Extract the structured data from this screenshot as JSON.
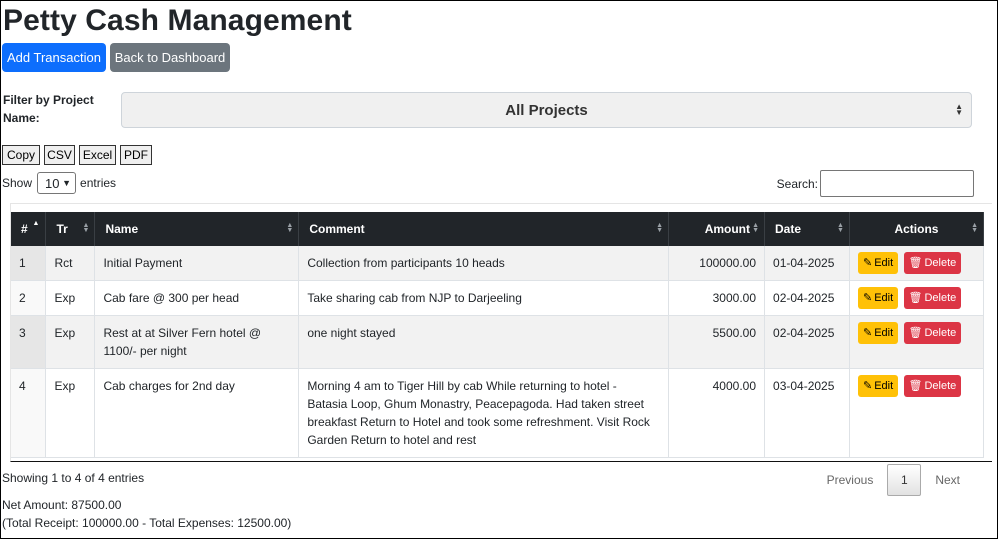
{
  "page": {
    "title": "Petty Cash Management"
  },
  "toolbar": {
    "add_label": "Add Transaction",
    "back_label": "Back to Dashboard"
  },
  "filter": {
    "label": "Filter by Project Name:",
    "selected": "All Projects"
  },
  "export": {
    "copy": "Copy",
    "csv": "CSV",
    "excel": "Excel",
    "pdf": "PDF"
  },
  "length": {
    "show": "Show",
    "value": "10",
    "entries": "entries"
  },
  "search": {
    "label": "Search:"
  },
  "table": {
    "headers": [
      "#",
      "Tr",
      "Name",
      "Comment",
      "Amount",
      "Date",
      "Actions"
    ],
    "edit_label": "Edit",
    "delete_label": "Delete",
    "rows": [
      {
        "no": "1",
        "tr": "Rct",
        "name": "Initial Payment",
        "comment": "Collection from participants 10 heads",
        "amount": "100000.00",
        "date": "01-04-2025"
      },
      {
        "no": "2",
        "tr": "Exp",
        "name": "Cab fare @ 300 per head",
        "comment": "Take sharing cab from NJP to Darjeeling",
        "amount": "3000.00",
        "date": "02-04-2025"
      },
      {
        "no": "3",
        "tr": "Exp",
        "name": "Rest at at Silver Fern hotel @ 1100/- per night",
        "comment": "one night stayed",
        "amount": "5500.00",
        "date": "02-04-2025"
      },
      {
        "no": "4",
        "tr": "Exp",
        "name": "Cab charges for 2nd day",
        "comment": "Morning 4 am to Tiger Hill by cab While returning to hotel - Batasia Loop, Ghum Monastry, Peacepagoda. Had taken street breakfast Return to Hotel and took some refreshment. Visit Rock Garden Return to hotel and rest",
        "amount": "4000.00",
        "date": "03-04-2025"
      }
    ]
  },
  "info": {
    "text": "Showing 1 to 4 of 4 entries"
  },
  "pagination": {
    "previous": "Previous",
    "current": "1",
    "next": "Next"
  },
  "totals": {
    "net": "Net Amount: 87500.00",
    "breakdown": "(Total Receipt: 100000.00 - Total Expenses: 12500.00)"
  },
  "colors": {
    "primary": "#0d6efd",
    "secondary": "#6c757d",
    "warning": "#ffc107",
    "danger": "#dc3545",
    "header_bg": "#212529"
  }
}
